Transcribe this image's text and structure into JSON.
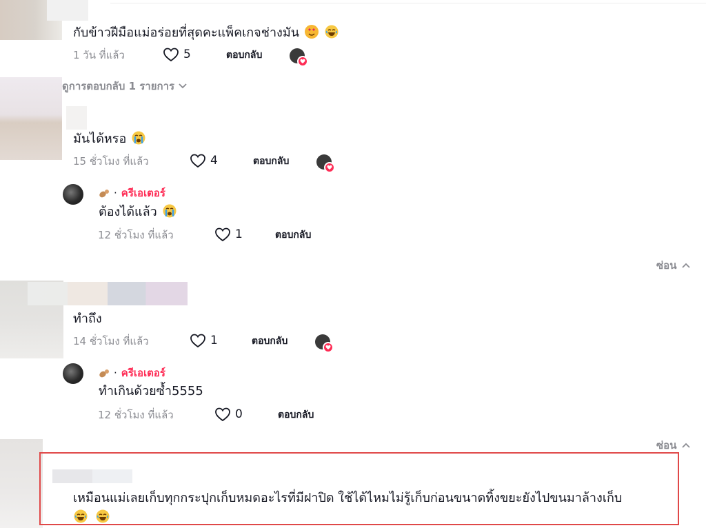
{
  "comments": [
    {
      "text": "กับข้าวฝีมือแม่อร่อยที่สุดคะแพ็คเกจช่างมัน",
      "time": "1 วัน ที่แล้ว",
      "likes": "5",
      "reply_label": "ตอบกลับ",
      "view_replies": "ดูการตอบกลับ 1 รายการ",
      "emoji": [
        "heart-eyes-emoji",
        "laughing-emoji"
      ]
    },
    {
      "text": "มันได้หรอ",
      "time": "15 ชั่วโมง ที่แล้ว",
      "likes": "4",
      "reply_label": "ตอบกลับ",
      "emoji": [
        "crying-emoji"
      ],
      "reply": {
        "creator_label": "ครีเอเตอร์",
        "text": "ต้องได้แล้ว",
        "time": "12 ชั่วโมง ที่แล้ว",
        "likes": "1",
        "reply_label": "ตอบกลับ",
        "emoji": [
          "crying-emoji"
        ]
      },
      "hide_label": "ซ่อน"
    },
    {
      "text": "ทำถึง",
      "time": "14 ชั่วโมง ที่แล้ว",
      "likes": "1",
      "reply_label": "ตอบกลับ",
      "reply": {
        "creator_label": "ครีเอเตอร์",
        "text": "ทำเกินด้วยซ้ำ5555",
        "time": "12 ชั่วโมง ที่แล้ว",
        "likes": "0",
        "reply_label": "ตอบกลับ"
      },
      "hide_label": "ซ่อน"
    },
    {
      "text": "เหมือนแม่เลยเก็บทุกกระปุกเก็บหมดอะไรที่มีฝาปิด ใช้ได้ไหมไม่รู้เก็บก่อนขนาดทิ้งขยะยังไปขนมาล้างเก็บ",
      "emoji": [
        "laughing-emoji",
        "laughing-emoji"
      ]
    }
  ],
  "colors": {
    "accent": "#fe2c55",
    "highlight_box": "#e04848",
    "muted": "#8a8b91"
  }
}
